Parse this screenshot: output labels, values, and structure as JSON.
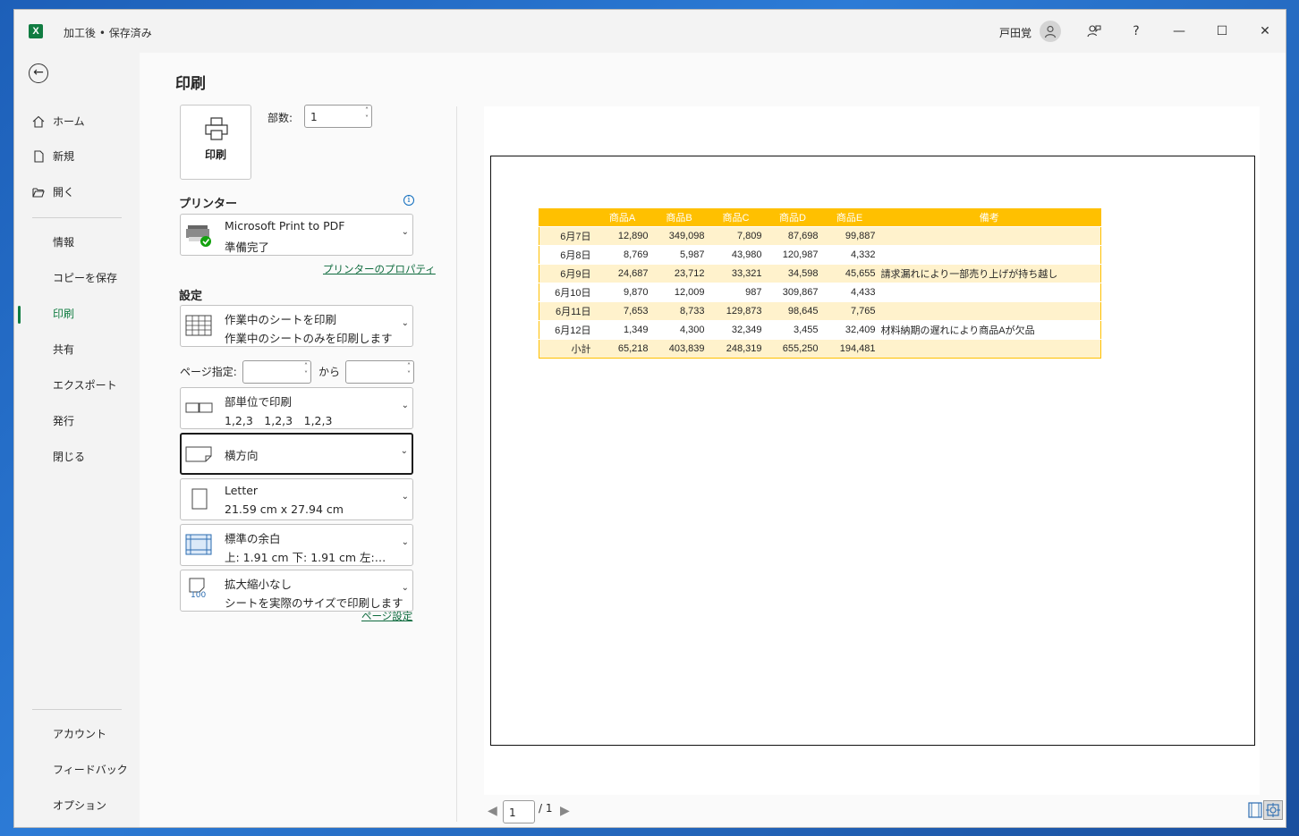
{
  "window": {
    "title": "加工後 • 保存済み",
    "app_icon_text": "X",
    "user_name": "戸田覚",
    "controls": {
      "feedback": "feedback-icon",
      "help": "?",
      "minimize": "—",
      "maximize": "☐",
      "close": "✕"
    }
  },
  "sidebar": {
    "back_icon": "back-arrow-icon",
    "top_items": [
      {
        "label": "ホーム",
        "icon": "home-icon"
      },
      {
        "label": "新規",
        "icon": "new-file-icon"
      },
      {
        "label": "開く",
        "icon": "folder-open-icon"
      }
    ],
    "items": [
      {
        "label": "情報"
      },
      {
        "label": "コピーを保存"
      },
      {
        "label": "印刷",
        "active": true
      },
      {
        "label": "共有"
      },
      {
        "label": "エクスポート"
      },
      {
        "label": "発行"
      },
      {
        "label": "閉じる"
      }
    ],
    "bottom_items": [
      {
        "label": "アカウント"
      },
      {
        "label": "フィードバック"
      },
      {
        "label": "オプション"
      }
    ]
  },
  "print": {
    "page_title": "印刷",
    "print_button_label": "印刷",
    "copies_label": "部数:",
    "copies_value": "1",
    "printer_section": "プリンター",
    "printer_name": "Microsoft Print to PDF",
    "printer_status": "準備完了",
    "printer_properties_link": "プリンターのプロパティ",
    "settings_section": "設定",
    "settings": {
      "scope_title": "作業中のシートを印刷",
      "scope_desc": "作業中のシートのみを印刷します",
      "pages_label": "ページ指定:",
      "pages_from": "",
      "pages_to_label": "から",
      "pages_to": "",
      "collate_title": "部単位で印刷",
      "collate_desc": "1,2,3　1,2,3　1,2,3",
      "orientation": "横方向",
      "paper_title": "Letter",
      "paper_desc": "21.59 cm x 27.94 cm",
      "margins_title": "標準の余白",
      "margins_desc": "上: 1.91 cm 下: 1.91 cm 左:…",
      "scaling_title": "拡大縮小なし",
      "scaling_desc": "シートを実際のサイズで印刷します",
      "scaling_icon_text": "100"
    },
    "page_setup_link": "ページ設定"
  },
  "preview": {
    "columns": [
      "",
      "商品A",
      "商品B",
      "商品C",
      "商品D",
      "商品E",
      "備考"
    ],
    "rows": [
      [
        "6月7日",
        "12,890",
        "349,098",
        "7,809",
        "87,698",
        "99,887",
        ""
      ],
      [
        "6月8日",
        "8,769",
        "5,987",
        "43,980",
        "120,987",
        "4,332",
        ""
      ],
      [
        "6月9日",
        "24,687",
        "23,712",
        "33,321",
        "34,598",
        "45,655",
        "請求漏れにより一部売り上げが持ち越し"
      ],
      [
        "6月10日",
        "9,870",
        "12,009",
        "987",
        "309,867",
        "4,433",
        ""
      ],
      [
        "6月11日",
        "7,653",
        "8,733",
        "129,873",
        "98,645",
        "7,765",
        ""
      ],
      [
        "6月12日",
        "1,349",
        "4,300",
        "32,349",
        "3,455",
        "32,409",
        "材料納期の遅れにより商品Aが欠品"
      ]
    ],
    "total": [
      "小計",
      "65,218",
      "403,839",
      "248,319",
      "655,250",
      "194,481",
      ""
    ],
    "current_page": "1",
    "page_total": "/ 1"
  },
  "colors": {
    "accent": "#107c41",
    "header_fill": "#ffc000",
    "band_fill": "#fff2cc"
  }
}
